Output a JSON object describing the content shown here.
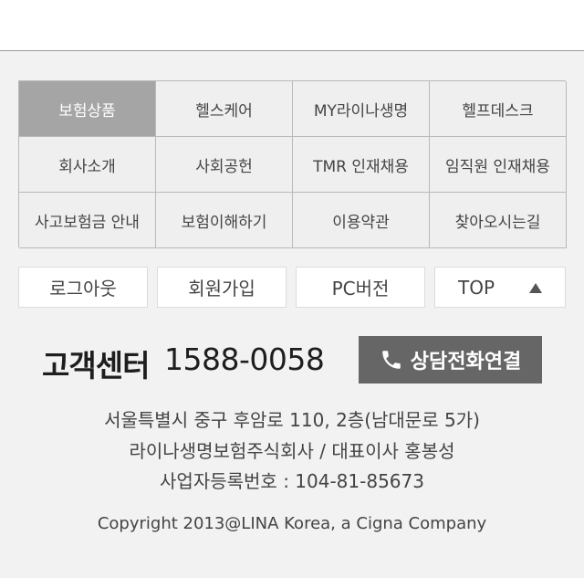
{
  "menu": {
    "items": [
      {
        "label": "보험상품"
      },
      {
        "label": "헬스케어"
      },
      {
        "label": "MY라이나생명"
      },
      {
        "label": "헬프데스크"
      },
      {
        "label": "회사소개"
      },
      {
        "label": "사회공헌"
      },
      {
        "label": "TMR 인재채용"
      },
      {
        "label": "임직원 인재채용"
      },
      {
        "label": "사고보험금 안내"
      },
      {
        "label": "보험이해하기"
      },
      {
        "label": "이용약관"
      },
      {
        "label": "찾아오시는길"
      }
    ],
    "active_index": 0,
    "active_color": "#a5a5a5"
  },
  "utility": {
    "logout_label": "로그아웃",
    "join_label": "회원가입",
    "pc_label": "PC버전",
    "top_label": "TOP",
    "top_icon": "triangle-up-icon"
  },
  "customer_center": {
    "label": "고객센터",
    "phone": "1588-0058",
    "call_button_label": "상담전화연결",
    "call_icon": "phone-icon",
    "button_color": "#666666"
  },
  "company_info": {
    "address": "서울특별시 중구 후암로 110, 2층(남대문로 5가)",
    "company": "라이나생명보험주식회사 / 대표이사 홍봉성",
    "business_no": "사업자등록번호 : 104-81-85673"
  },
  "footer": {
    "copyright": "Copyright 2013@LINA Korea, a Cigna Company"
  }
}
